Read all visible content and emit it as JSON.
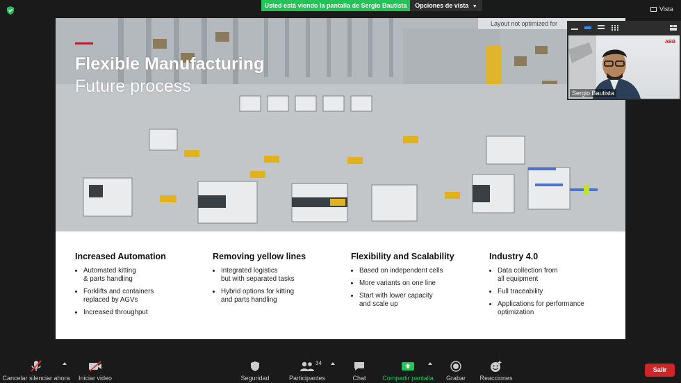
{
  "topbar": {
    "share_banner": "Usted está viendo la pantalla de Sergio Bautista",
    "view_options": "Opciones de vista",
    "view_label": "Vista"
  },
  "slide": {
    "title": "Flexible Manufacturing",
    "subtitle": "Future process",
    "layout_note": "Layout not optimized for",
    "columns": [
      {
        "heading": "Increased Automation",
        "bullets": [
          "Automated kitting\n& parts handling",
          "Forklifts and containers\nreplaced by AGVs",
          "Increased throughput"
        ]
      },
      {
        "heading": "Removing yellow lines",
        "bullets": [
          "Integrated logistics\nbut with separated tasks",
          "Hybrid options for kitting\nand parts handling"
        ]
      },
      {
        "heading": "Flexibility and Scalability",
        "bullets": [
          "Based on independent cells",
          "More variants on one line",
          "Start with lower capacity\nand scale up"
        ]
      },
      {
        "heading": "Industry 4.0",
        "bullets": [
          "Data collection from\nall equipment",
          "Full traceability",
          "Applications for performance\noptimization"
        ]
      }
    ]
  },
  "video": {
    "participant_name": "Sergio Bautista",
    "logo_text": "ABB"
  },
  "toolbar": {
    "mute_label": "Cancelar silenciar ahora",
    "video_label": "Iniciar video",
    "security_label": "Seguridad",
    "participants_label": "Participantes",
    "participants_count": "34",
    "chat_label": "Chat",
    "share_label": "Compartir pantalla",
    "record_label": "Grabar",
    "reactions_label": "Reacciones",
    "leave_label": "Salir"
  },
  "colors": {
    "share_green": "#23c35a",
    "leave_red": "#d0242b",
    "abb_red": "#ff000f"
  }
}
